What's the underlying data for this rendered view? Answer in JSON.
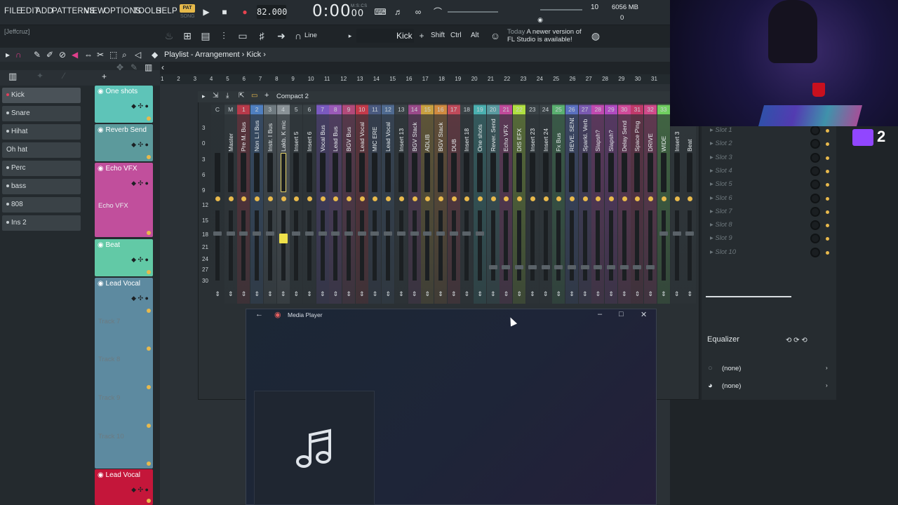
{
  "menu": [
    "FILE",
    "EDIT",
    "ADD",
    "PATTERNS",
    "VIEW",
    "OPTIONS",
    "TOOLS",
    "HELP"
  ],
  "pattern_mode": {
    "pat": "PAT",
    "song": "SONG"
  },
  "tempo": "82.000",
  "time": {
    "main": "0:00",
    "frac": "00",
    "unit": "M:S:CS"
  },
  "cpu": "10",
  "memory": "6056 MB",
  "polyphony": "0",
  "user": "[Jeffcruz]",
  "toolbar": {
    "snap": "Line",
    "channel": "Kick",
    "shift": "Shift",
    "ctrl": "Ctrl",
    "alt": "Alt",
    "news_day": "Today",
    "news_text": "A newer version of",
    "news_text2": "FL Studio is available!"
  },
  "playlist": {
    "title": "Playlist - Arrangement",
    "crumb": "Kick"
  },
  "channels": [
    "Kick",
    "Snare",
    "Hihat",
    "Oh hat",
    "Perc",
    "bass",
    "808",
    "Ins 2"
  ],
  "tracks": [
    {
      "name": "One shots",
      "color": "#5ec4b8"
    },
    {
      "name": "Reverb Send",
      "color": "#5c9a9c"
    },
    {
      "name": "Echo VFX",
      "color": "#c14f9c",
      "sub": "Echo VFX"
    },
    {
      "name": "Beat",
      "color": "#62c9a6"
    },
    {
      "name": "Lead Vocal",
      "color": "#5d8aa0"
    },
    {
      "name": "Track 7"
    },
    {
      "name": "Track 8"
    },
    {
      "name": "Track 9"
    },
    {
      "name": "Track 10"
    },
    {
      "name": "Lead Vocal",
      "color": "#c4163a"
    }
  ],
  "timeline_ticks": [
    "1",
    "2",
    "3",
    "4",
    "5",
    "6",
    "7",
    "8",
    "9",
    "10",
    "11",
    "12",
    "13",
    "14",
    "15",
    "16",
    "17",
    "18",
    "19",
    "20",
    "21",
    "22",
    "23",
    "24",
    "25",
    "26",
    "27",
    "28",
    "29",
    "30",
    "31"
  ],
  "mixer": {
    "title": "Compact 2",
    "db": [
      "3",
      "0",
      "3",
      "6",
      "9",
      "12",
      "15",
      "18",
      "21",
      "24",
      "27",
      "30"
    ],
    "strips": [
      {
        "num": "C",
        "name": "",
        "color": "#2c3337"
      },
      {
        "num": "M",
        "name": "Master",
        "color": "#3a4246"
      },
      {
        "num": "1",
        "name": "Pre M. Bus",
        "color": "#b83a4a"
      },
      {
        "num": "2",
        "name": "Non L.I Bus",
        "color": "#4f7fc0"
      },
      {
        "num": "3",
        "name": "Instr. I Bus",
        "color": "#6f7a80"
      },
      {
        "num": "4",
        "name": "Lakb. K mic",
        "color": "#8a9297"
      },
      {
        "num": "5",
        "name": "Insert 5",
        "color": "#3a4246"
      },
      {
        "num": "6",
        "name": "Insert 6",
        "color": "#3a4246"
      },
      {
        "num": "7",
        "name": "Vocal Bus",
        "color": "#7a5ac0"
      },
      {
        "num": "8",
        "name": "Lead Bus",
        "color": "#9a5ab8"
      },
      {
        "num": "9",
        "name": "BGV Bus",
        "color": "#b24a7a"
      },
      {
        "num": "10",
        "name": "Lead Vocal",
        "color": "#c43a4a"
      },
      {
        "num": "11",
        "name": "MIC ERE",
        "color": "#4a5a80"
      },
      {
        "num": "12",
        "name": "Lead Vocal",
        "color": "#4f6a90"
      },
      {
        "num": "13",
        "name": "Insert 13",
        "color": "#3a4246"
      },
      {
        "num": "14",
        "name": "BGV Stack",
        "color": "#9a4a8a"
      },
      {
        "num": "15",
        "name": "ADLIB",
        "color": "#c8a040"
      },
      {
        "num": "16",
        "name": "BGV Stack",
        "color": "#d08a40"
      },
      {
        "num": "17",
        "name": "DUB",
        "color": "#c04a5a"
      },
      {
        "num": "18",
        "name": "Insert 18",
        "color": "#3a4246"
      },
      {
        "num": "19",
        "name": "One shots",
        "color": "#4ab0b0"
      },
      {
        "num": "20",
        "name": "Rever. Send",
        "color": "#5a9aa0"
      },
      {
        "num": "21",
        "name": "Echo VFX",
        "color": "#c04a9a"
      },
      {
        "num": "22",
        "name": "DIS EFX",
        "color": "#b0e040"
      },
      {
        "num": "23",
        "name": "Insert 23",
        "color": "#3a4246"
      },
      {
        "num": "24",
        "name": "Insert 24",
        "color": "#3a4246"
      },
      {
        "num": "25",
        "name": "Fx Bus",
        "color": "#5ab070"
      },
      {
        "num": "26",
        "name": "REVE. SEND",
        "color": "#5a70c0"
      },
      {
        "num": "27",
        "name": "Sparkl. Verb",
        "color": "#7a5ab0"
      },
      {
        "num": "28",
        "name": "Slapsh?",
        "color": "#c04ab0"
      },
      {
        "num": "29",
        "name": "Slapsh?",
        "color": "#b04ac0"
      },
      {
        "num": "30",
        "name": "Delay Send",
        "color": "#d04a9a"
      },
      {
        "num": "31",
        "name": "Space Ping",
        "color": "#c03a6a"
      },
      {
        "num": "32",
        "name": "DRIVE",
        "color": "#d04a8a"
      },
      {
        "num": "33",
        "name": "WIDE",
        "color": "#70d060"
      },
      {
        "num": "",
        "name": "Insert 3",
        "color": "#3a4246"
      },
      {
        "num": "",
        "name": "Beat",
        "color": "#3a4246"
      }
    ],
    "slots": [
      "Slot 1",
      "Slot 2",
      "Slot 3",
      "Slot 4",
      "Slot 5",
      "Slot 6",
      "Slot 7",
      "Slot 8",
      "Slot 9",
      "Slot 10"
    ],
    "equalizer": "Equalizer",
    "in_route": "(none)",
    "out_route": "(none)"
  },
  "media_player": {
    "title": "Media Player",
    "art_icon": "music-note-icon"
  },
  "overlay": {
    "twitch_count": "2"
  },
  "colors": {
    "accent": "#e8b94c",
    "background": "#1f2428"
  }
}
